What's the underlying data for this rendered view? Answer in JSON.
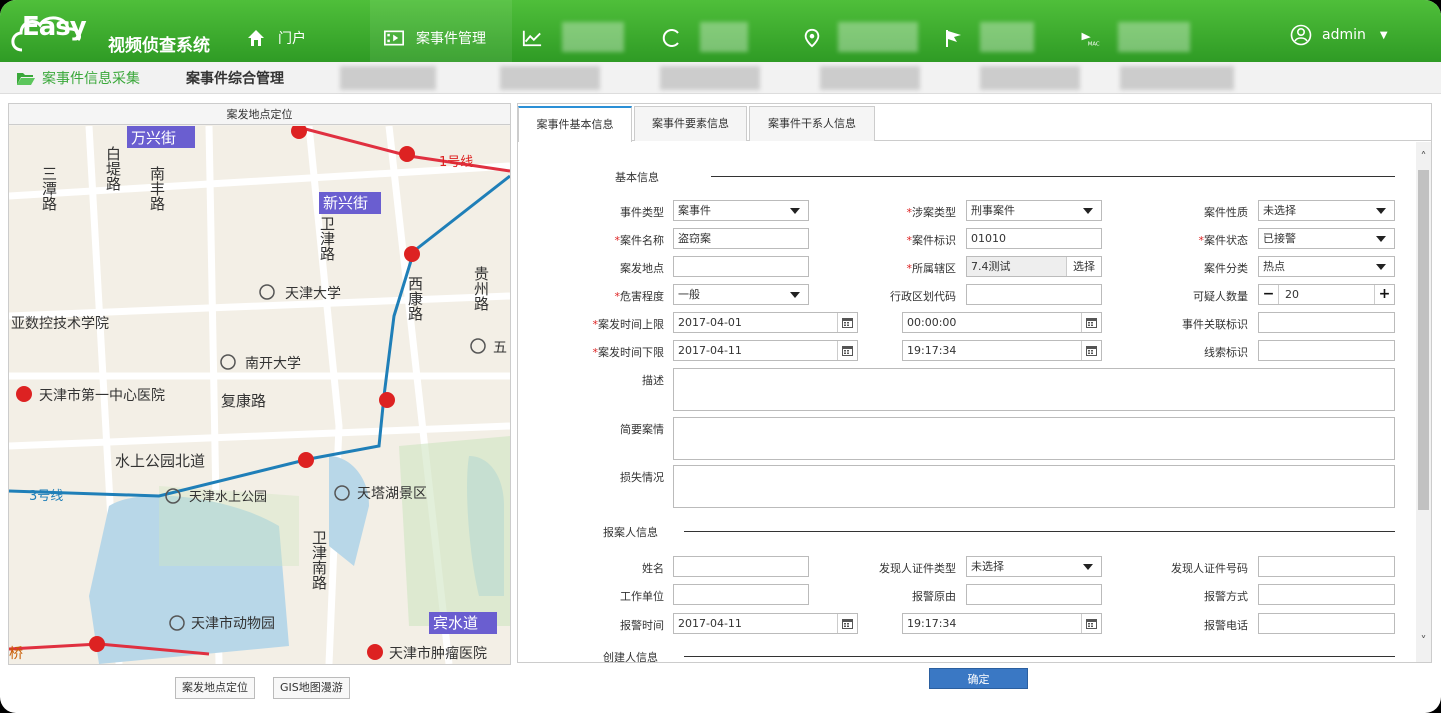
{
  "app": {
    "logo": "Easy",
    "title": "视频侦查系统"
  },
  "nav": {
    "portal": "门户",
    "case_mgmt": "案事件管理"
  },
  "user": {
    "name": "admin"
  },
  "subnav": {
    "collect": "案事件信息采集",
    "manage": "案事件综合管理"
  },
  "map": {
    "header": "案发地点定位",
    "labels": [
      "万兴街",
      "三潭路",
      "白堤路",
      "南丰路",
      "新兴街",
      "1号线",
      "卫津路",
      "天津大学",
      "贵州路",
      "西康路",
      "亚数控技术学院",
      "南开大学",
      "五",
      "天津市第一中心医院",
      "复康路",
      "水上公园北道",
      "3号线",
      "天津水上公园",
      "天塔湖景区",
      "卫津南路",
      "天津市动物园",
      "宾水道",
      "桥",
      "天津市肿瘤医院"
    ],
    "btn_locate": "案发地点定位",
    "btn_gis": "GIS地图漫游"
  },
  "tabs": [
    "案事件基本信息",
    "案事件要素信息",
    "案事件干系人信息"
  ],
  "sections": {
    "basic": "基本信息",
    "reporter": "报案人信息",
    "creator": "创建人信息"
  },
  "form": {
    "event_type": {
      "label": "事件类型",
      "value": "案事件"
    },
    "case_type": {
      "label": "涉案类型",
      "value": "刑事案件"
    },
    "case_nature": {
      "label": "案件性质",
      "value": "未选择"
    },
    "case_name": {
      "label": "案件名称",
      "value": "盗窃案"
    },
    "case_id": {
      "label": "案件标识",
      "value": "01010"
    },
    "case_status": {
      "label": "案件状态",
      "value": "已接警"
    },
    "location": {
      "label": "案发地点",
      "value": ""
    },
    "jurisdiction": {
      "label": "所属辖区",
      "value": "7.4测试",
      "btn": "选择"
    },
    "category": {
      "label": "案件分类",
      "value": "热点"
    },
    "harm": {
      "label": "危害程度",
      "value": "一般"
    },
    "region_code": {
      "label": "行政区划代码",
      "value": ""
    },
    "suspects": {
      "label": "可疑人数量",
      "value": "20",
      "minus": "−",
      "plus": "+"
    },
    "time_upper": {
      "label": "案发时间上限",
      "date": "2017-04-01",
      "time": "00:00:00"
    },
    "related_id": {
      "label": "事件关联标识",
      "value": ""
    },
    "time_lower": {
      "label": "案发时间下限",
      "date": "2017-04-11",
      "time": "19:17:34"
    },
    "clue_id": {
      "label": "线索标识",
      "value": ""
    },
    "description": {
      "label": "描述"
    },
    "summary": {
      "label": "简要案情"
    },
    "loss": {
      "label": "损失情况"
    },
    "rep_name": {
      "label": "姓名",
      "value": ""
    },
    "rep_id_type": {
      "label": "发现人证件类型",
      "value": "未选择"
    },
    "rep_id_no": {
      "label": "发现人证件号码",
      "value": ""
    },
    "rep_work": {
      "label": "工作单位",
      "value": ""
    },
    "rep_reason": {
      "label": "报警原由",
      "value": ""
    },
    "rep_method": {
      "label": "报警方式",
      "value": ""
    },
    "rep_time": {
      "label": "报警时间",
      "date": "2017-04-11",
      "time": "19:17:34"
    },
    "rep_phone": {
      "label": "报警电话",
      "value": ""
    }
  },
  "confirm": "确定",
  "colors": {
    "nav_green": "#3cae2f",
    "accent_blue": "#3a78c4",
    "required_red": "#dd2222"
  }
}
